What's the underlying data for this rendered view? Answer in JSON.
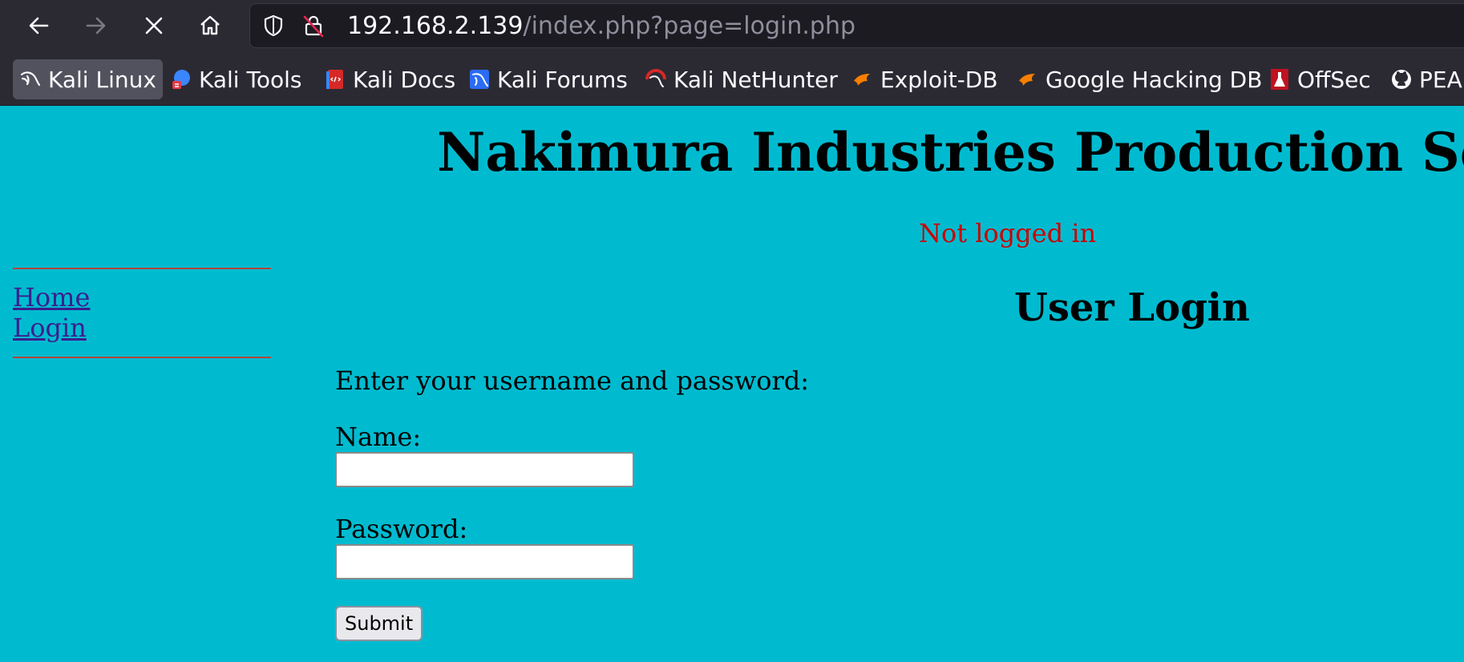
{
  "browser": {
    "url_host": "192.168.2.139",
    "url_path": "/index.php?page=login.php",
    "nav_icons": [
      "back-arrow-icon",
      "forward-arrow-icon",
      "stop-icon",
      "home-icon"
    ],
    "bookmarks": [
      {
        "label": "Kali Linux",
        "icon": "kali-dragon-icon",
        "active": true
      },
      {
        "label": "Kali Tools",
        "icon": "kali-tools-icon"
      },
      {
        "label": "Kali Docs",
        "icon": "kali-docs-icon"
      },
      {
        "label": "Kali Forums",
        "icon": "kali-forums-icon"
      },
      {
        "label": "Kali NetHunter",
        "icon": "kali-nethunter-icon"
      },
      {
        "label": "Exploit-DB",
        "icon": "exploit-db-icon"
      },
      {
        "label": "Google Hacking DB",
        "icon": "ghdb-icon"
      },
      {
        "label": "OffSec",
        "icon": "offsec-icon"
      },
      {
        "label": "PEA",
        "icon": "github-icon"
      }
    ]
  },
  "page": {
    "title": "Nakimura Industries Production Se",
    "login_status": "Not logged in",
    "nav": {
      "home": "Home",
      "login": "Login"
    },
    "form": {
      "heading": "User Login",
      "intro": "Enter your username and password:",
      "name_label": "Name:",
      "name_value": "",
      "password_label": "Password:",
      "password_value": "",
      "submit_label": "Submit"
    }
  },
  "colors": {
    "page_background": "#00bbd0",
    "status_red": "#cc0000",
    "link_purple": "#3b1f8e",
    "rule": "#b5453a",
    "chrome_dark": "#2b2a33"
  }
}
